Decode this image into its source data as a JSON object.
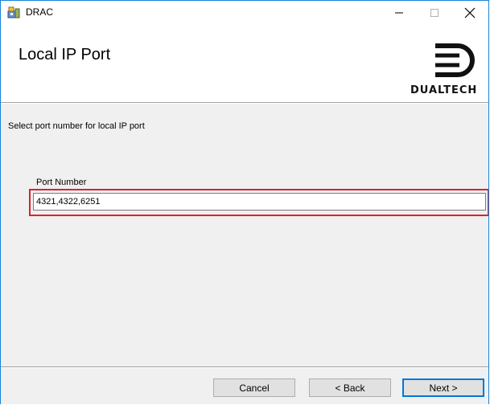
{
  "window": {
    "title": "DRAC",
    "controls": {
      "minimize": "–",
      "maximize": "☐",
      "close": "✕"
    }
  },
  "header": {
    "title": "Local IP Port",
    "logo_text": "DUALTECH"
  },
  "main": {
    "instruction": "Select port number for local IP port",
    "port_label": "Port Number",
    "port_value": "4321,4322,6251"
  },
  "buttons": {
    "cancel": "Cancel",
    "back": "< Back",
    "next": "Next >"
  },
  "colors": {
    "highlight": "#d7232f",
    "focus": "#0078d7"
  }
}
